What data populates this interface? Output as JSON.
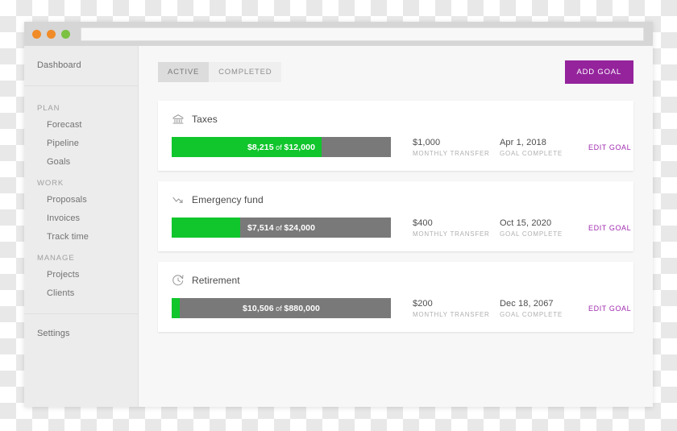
{
  "window": {
    "dots": [
      {
        "name": "close",
        "color": "#f08b28"
      },
      {
        "name": "minimize",
        "color": "#f08b28"
      },
      {
        "name": "maximize",
        "color": "#7cc142"
      }
    ],
    "url": ""
  },
  "sidebar": {
    "top": [
      {
        "label": "Dashboard",
        "name": "dashboard"
      }
    ],
    "sections": [
      {
        "title": "PLAN",
        "items": [
          {
            "label": "Forecast",
            "name": "forecast"
          },
          {
            "label": "Pipeline",
            "name": "pipeline"
          },
          {
            "label": "Goals",
            "name": "goals"
          }
        ]
      },
      {
        "title": "WORK",
        "items": [
          {
            "label": "Proposals",
            "name": "proposals"
          },
          {
            "label": "Invoices",
            "name": "invoices"
          },
          {
            "label": "Track time",
            "name": "track-time"
          }
        ]
      },
      {
        "title": "MANAGE",
        "items": [
          {
            "label": "Projects",
            "name": "projects"
          },
          {
            "label": "Clients",
            "name": "clients"
          }
        ]
      }
    ],
    "bottom": [
      {
        "label": "Settings",
        "name": "settings"
      }
    ]
  },
  "toolbar": {
    "tabs": [
      {
        "label": "ACTIVE",
        "name": "active",
        "selected": true
      },
      {
        "label": "COMPLETED",
        "name": "completed",
        "selected": false
      }
    ],
    "add_goal_label": "ADD GOAL",
    "add_goal_color": "#94239c"
  },
  "labels": {
    "of": "of",
    "monthly_transfer": "MONTHLY TRANSFER",
    "goal_complete": "GOAL COMPLETE",
    "edit_goal": "EDIT GOAL"
  },
  "colors": {
    "progress_fill": "#10c62c",
    "progress_track": "#797979",
    "accent_purple": "#94239c",
    "link_purple": "#a02bb0"
  },
  "goals": [
    {
      "name": "taxes",
      "title": "Taxes",
      "icon": "bank-icon",
      "current": "$8,215",
      "target": "$12,000",
      "percent": 68.5,
      "monthly_transfer": "$1,000",
      "complete_date": "Apr 1, 2018"
    },
    {
      "name": "emergency-fund",
      "title": "Emergency fund",
      "icon": "trend-down-icon",
      "current": "$7,514",
      "target": "$24,000",
      "percent": 31.3,
      "monthly_transfer": "$400",
      "complete_date": "Oct 15, 2020"
    },
    {
      "name": "retirement",
      "title": "Retirement",
      "icon": "clock-rotate-icon",
      "current": "$10,506",
      "target": "$880,000",
      "percent": 3.5,
      "monthly_transfer": "$200",
      "complete_date": "Dec 18, 2067"
    }
  ]
}
